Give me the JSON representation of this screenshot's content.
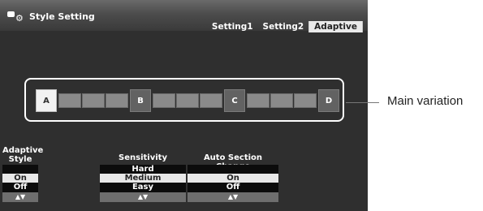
{
  "window": {
    "title": "Style Setting",
    "icon": "style-setting-icon"
  },
  "tabs": [
    {
      "label": "Setting1",
      "active": false
    },
    {
      "label": "Setting2",
      "active": false
    },
    {
      "label": "Adaptive",
      "active": true
    }
  ],
  "variation": {
    "nodes": [
      "A",
      "B",
      "C",
      "D"
    ],
    "selected": "A",
    "callout": "Main variation"
  },
  "params": {
    "adaptive_style": {
      "label_line1": "Adaptive",
      "label_line2": "Style",
      "options": [
        "On",
        "Off"
      ],
      "selected": "On",
      "arrows": "▲▼"
    },
    "sensitivity": {
      "label": "Sensitivity",
      "options": [
        "Hard",
        "Medium",
        "Easy"
      ],
      "selected": "Medium",
      "arrows": "▲▼"
    },
    "auto_section_change": {
      "label": "Auto Section Change",
      "options": [
        "On",
        "Off"
      ],
      "selected": "On",
      "arrows": "▲▼"
    }
  }
}
